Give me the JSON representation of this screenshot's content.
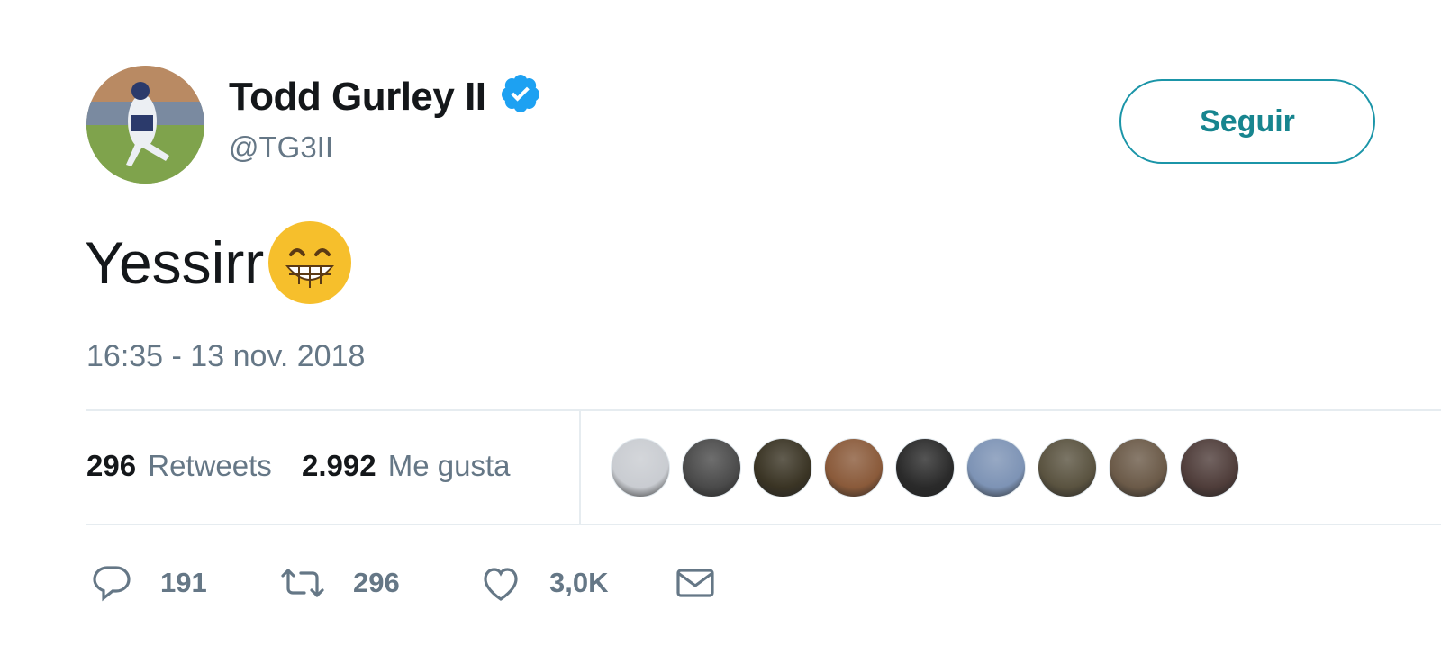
{
  "tweet": {
    "author": {
      "display_name": "Todd Gurley II",
      "handle": "@TG3II",
      "verified": true
    },
    "follow_label": "Seguir",
    "text": "Yessirr",
    "emoji": "grinning-face-with-smiling-eyes",
    "timestamp": "16:35 - 13 nov. 2018",
    "stats": {
      "retweets_count": "296",
      "retweets_label": "Retweets",
      "likes_count": "2.992",
      "likes_label": "Me gusta"
    },
    "likers": [
      {
        "color": "#c9ccd1"
      },
      {
        "color": "#4a4a4a"
      },
      {
        "color": "#3a3424"
      },
      {
        "color": "#8a5a3a"
      },
      {
        "color": "#2a2a2a"
      },
      {
        "color": "#7d93b5"
      },
      {
        "color": "#5a5340"
      },
      {
        "color": "#6b5a48"
      },
      {
        "color": "#4f3d3a"
      }
    ],
    "actions": {
      "reply_count": "191",
      "retweet_count": "296",
      "like_count": "3,0K"
    }
  },
  "colors": {
    "verified_blue": "#1da1f2",
    "follow_teal": "#1b95a8",
    "secondary_text": "#657786",
    "divider": "#e6ecf0"
  }
}
